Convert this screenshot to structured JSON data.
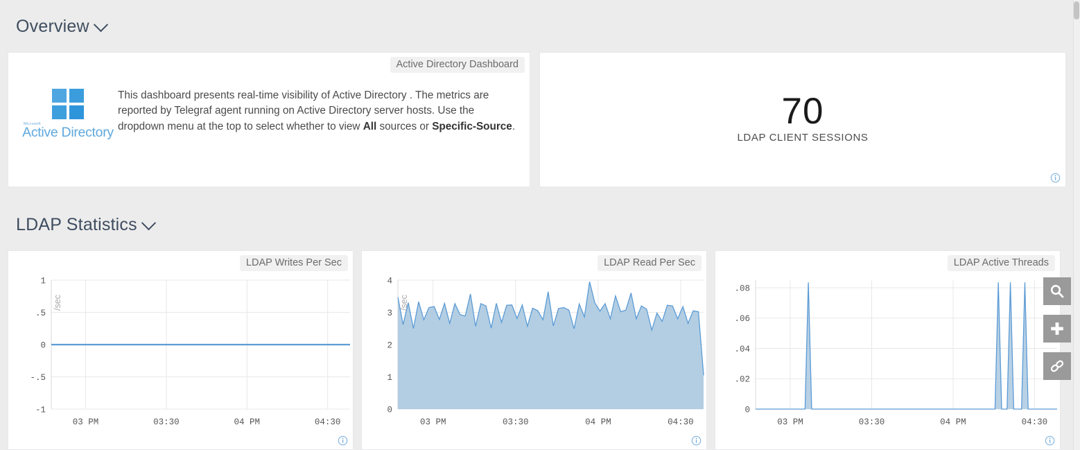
{
  "sections": {
    "overview": {
      "title": "Overview",
      "chevron": "chevron-down-icon"
    },
    "ldap": {
      "title": "LDAP Statistics",
      "chevron": "chevron-down-icon"
    }
  },
  "intro_panel": {
    "title": "Active Directory Dashboard",
    "logo": {
      "brand_small": "Microsoft",
      "brand_name": "Active Directory",
      "icon": "windows-logo-icon"
    },
    "text_part1": "This dashboard presents real-time visibility of Active Directory . The metrics are reported by Telegraf agent running on Active Directory server hosts. Use the dropdown menu at the top to select whether to view ",
    "text_bold1": "All",
    "text_part2": " sources or ",
    "text_bold2": "Specific-Source",
    "text_part3": "."
  },
  "stat_panel": {
    "value": "70",
    "label": "LDAP CLIENT SESSIONS",
    "info_icon": "info-icon"
  },
  "toolbar": {
    "buttons": [
      {
        "name": "search-button",
        "icon": "magnifier-icon"
      },
      {
        "name": "add-button",
        "icon": "plus-icon"
      },
      {
        "name": "link-button",
        "icon": "chain-link-icon"
      }
    ]
  },
  "colors": {
    "background": "#ececec",
    "panel": "#ffffff",
    "line": "#5b9bd5",
    "area_fill": "#abc9e0",
    "heading": "#3f4d60",
    "badge_bg": "#f1f1f1",
    "toolbar_bg": "#9a9a9a"
  },
  "chart_data": [
    {
      "type": "line",
      "title": "LDAP Writes Per Sec",
      "ylabel": "/sec",
      "xlabel": "",
      "ylim": [
        -1,
        1
      ],
      "yticks": [
        "1",
        ".5",
        "0",
        "-.5",
        "-1"
      ],
      "ytick_values": [
        1,
        0.5,
        0,
        -0.5,
        -1
      ],
      "xticks": [
        "03 PM",
        "03:30",
        "04 PM",
        "04:30"
      ],
      "xtick_positions": [
        0.115,
        0.385,
        0.655,
        0.925
      ],
      "grid": true,
      "series": [
        {
          "name": "writes per sec",
          "values": [
            0,
            0,
            0,
            0,
            0,
            0,
            0,
            0,
            0,
            0,
            0,
            0,
            0,
            0,
            0,
            0,
            0,
            0,
            0,
            0,
            0,
            0,
            0,
            0,
            0,
            0,
            0,
            0,
            0,
            0,
            0,
            0,
            0,
            0,
            0,
            0,
            0,
            0,
            0,
            0
          ]
        }
      ],
      "info_icon": "info-icon"
    },
    {
      "type": "area",
      "title": "LDAP Read Per Sec",
      "ylabel": "/sec",
      "xlabel": "",
      "ylim": [
        0,
        4
      ],
      "yticks": [
        "4",
        "3",
        "2",
        "1",
        "0"
      ],
      "ytick_values": [
        4,
        3,
        2,
        1,
        0
      ],
      "xticks": [
        "03 PM",
        "03:30",
        "04 PM",
        "04:30"
      ],
      "xtick_positions": [
        0.115,
        0.385,
        0.655,
        0.925
      ],
      "grid": true,
      "series": [
        {
          "name": "reads per sec",
          "values": [
            3.47,
            2.62,
            3.3,
            2.5,
            3.33,
            2.77,
            3.15,
            3.18,
            2.78,
            3.28,
            2.66,
            3.27,
            2.93,
            2.89,
            3.57,
            2.57,
            3.27,
            3.2,
            2.51,
            3.28,
            2.69,
            3.22,
            3.23,
            2.81,
            3.23,
            2.57,
            3.13,
            3.05,
            2.77,
            3.64,
            2.58,
            3.12,
            3.15,
            3.07,
            2.49,
            3.26,
            2.86,
            3.95,
            3.3,
            3.04,
            3.27,
            2.8,
            3.51,
            3.02,
            3.07,
            3.6,
            2.8,
            3.2,
            3.1,
            2.45,
            2.98,
            2.72,
            3.22,
            3.2,
            2.8,
            3.18,
            2.66,
            3.05,
            3.02,
            1.05
          ]
        }
      ],
      "info_icon": "info-icon"
    },
    {
      "type": "area",
      "title": "LDAP Active Threads",
      "ylabel": "",
      "xlabel": "",
      "ylim": [
        0,
        0.085
      ],
      "yticks": [
        ".08",
        ".06",
        ".04",
        ".02",
        "0"
      ],
      "ytick_values": [
        0.08,
        0.06,
        0.04,
        0.02,
        0
      ],
      "xticks": [
        "03 PM",
        "03:30",
        "04 PM",
        "04:30"
      ],
      "xtick_positions": [
        0.115,
        0.385,
        0.655,
        0.925
      ],
      "grid": true,
      "series": [
        {
          "name": "active threads",
          "spikes": [
            {
              "x": 0.175,
              "peak": 0.0835
            },
            {
              "x": 0.805,
              "peak": 0.0835
            },
            {
              "x": 0.845,
              "peak": 0.0835
            },
            {
              "x": 0.893,
              "peak": 0.0835
            }
          ],
          "baseline": 0
        }
      ],
      "info_icon": "info-icon"
    }
  ]
}
